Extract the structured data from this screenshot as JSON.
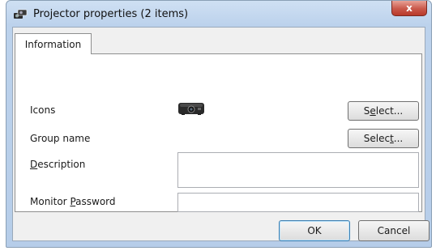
{
  "window": {
    "title": "Projector properties (2 items)",
    "close_label": "x"
  },
  "tabs": [
    {
      "label": "Information",
      "selected": true
    }
  ],
  "fields": {
    "icons": {
      "label": "Icons",
      "icon": "projector-icon",
      "button": {
        "pre": "S",
        "key": "e",
        "post": "lect..."
      }
    },
    "group_name": {
      "label": "Group name",
      "button": {
        "pre": "Selec",
        "key": "t",
        "post": "..."
      }
    },
    "description": {
      "pre": "",
      "key": "D",
      "post": "escription",
      "value": ""
    },
    "monitor_password": {
      "pre": "Monitor ",
      "key": "P",
      "post": "assword",
      "value": ""
    }
  },
  "footer": {
    "ok_label": "OK",
    "cancel_label": "Cancel"
  },
  "colors": {
    "title_bar": "#bcd2ec",
    "close_button": "#c9584a",
    "default_button_border": "#3c7fb1"
  }
}
